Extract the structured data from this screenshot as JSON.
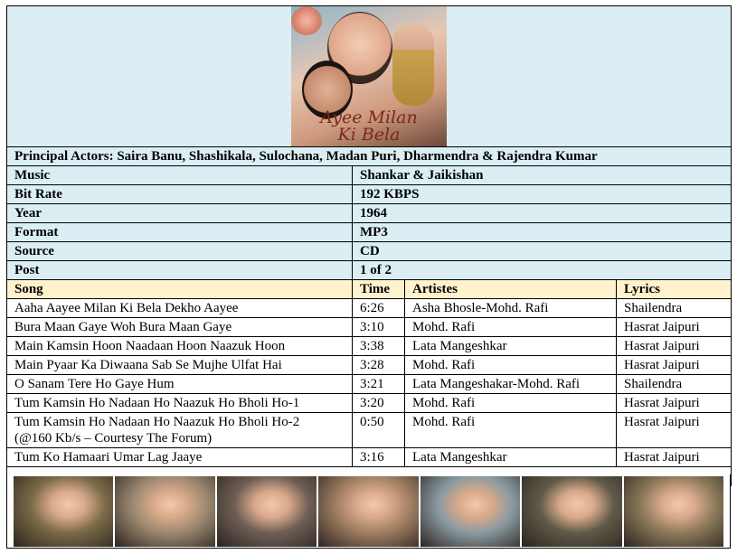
{
  "poster": {
    "title_line1": "Ayee Milan",
    "title_line2": "Ki Bela"
  },
  "principal_actors": "Principal Actors: Saira Banu, Shashikala, Sulochana, Madan Puri, Dharmendra & Rajendra Kumar",
  "info": [
    {
      "label": "Music",
      "value": "Shankar & Jaikishan"
    },
    {
      "label": "Bit Rate",
      "value": "192 KBPS"
    },
    {
      "label": "Year",
      "value": "1964"
    },
    {
      "label": "Format",
      "value": "MP3"
    },
    {
      "label": "Source",
      "value": "CD"
    },
    {
      "label": "Post",
      "value": "1 of 2"
    }
  ],
  "headers": {
    "song": "Song",
    "time": "Time",
    "artistes": "Artistes",
    "lyrics": "Lyrics"
  },
  "songs": [
    {
      "song": "Aaha Aayee Milan Ki Bela Dekho Aayee",
      "time": "6:26",
      "artistes": "Asha Bhosle-Mohd. Rafi",
      "lyrics": "Shailendra"
    },
    {
      "song": "Bura Maan Gaye Woh Bura Maan Gaye",
      "time": "3:10",
      "artistes": "Mohd. Rafi",
      "lyrics": "Hasrat Jaipuri"
    },
    {
      "song": "Main Kamsin Hoon Naadaan Hoon Naazuk Hoon",
      "time": "3:38",
      "artistes": "Lata Mangeshkar",
      "lyrics": "Hasrat Jaipuri"
    },
    {
      "song": "Main Pyaar Ka Diwaana Sab Se Mujhe Ulfat Hai",
      "time": "3:28",
      "artistes": "Mohd. Rafi",
      "lyrics": "Hasrat Jaipuri"
    },
    {
      "song": "O Sanam Tere Ho Gaye Hum",
      "time": "3:21",
      "artistes": "Lata Mangeshakar-Mohd. Rafi",
      "lyrics": "Shailendra"
    },
    {
      "song": "Tum Kamsin Ho Nadaan Ho Naazuk Ho Bholi Ho-1",
      "time": "3:20",
      "artistes": "Mohd. Rafi",
      "lyrics": "Hasrat Jaipuri"
    },
    {
      "song": "Tum Kamsin Ho Nadaan Ho Naazuk Ho Bholi Ho-2",
      "song_line2": "(@160 Kb/s – Courtesy The Forum)",
      "time": "0:50",
      "artistes": "Mohd. Rafi",
      "lyrics": "Hasrat Jaipuri"
    },
    {
      "song": "Tum Ko Hamaari Umar Lag Jaaye",
      "time": "3:16",
      "artistes": "Lata Mangeshkar",
      "lyrics": "Hasrat Jaipuri"
    }
  ],
  "filmstrip_colors": [
    "#7a6a48",
    "#9b8870",
    "#6f5f55",
    "#a07e62",
    "#8a9aa0",
    "#5f5a48",
    "#8c7a5a"
  ]
}
